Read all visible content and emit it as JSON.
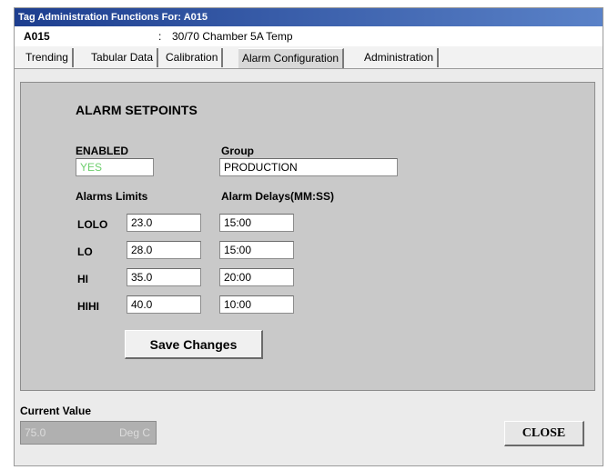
{
  "window": {
    "title": "Tag Administration Functions For: A015"
  },
  "tag": {
    "id": "A015",
    "separator": ":",
    "description": "30/70 Chamber 5A Temp"
  },
  "tabs": [
    {
      "label": "Trending",
      "active": false
    },
    {
      "label": "Tabular Data",
      "active": false
    },
    {
      "label": "Calibration",
      "active": false
    },
    {
      "label": "Alarm Configuration",
      "active": true
    },
    {
      "label": "Administration",
      "active": false
    }
  ],
  "alarm": {
    "heading": "ALARM SETPOINTS",
    "enabled_label": "ENABLED",
    "enabled_value": "YES",
    "group_label": "Group",
    "group_value": "PRODUCTION",
    "limits_label": "Alarms Limits",
    "delays_label": "Alarm Delays(MM:SS)",
    "rows": [
      {
        "name": "LOLO",
        "limit": "23.0",
        "delay": "15:00"
      },
      {
        "name": "LO",
        "limit": "28.0",
        "delay": "15:00"
      },
      {
        "name": "HI",
        "limit": "35.0",
        "delay": "20:00"
      },
      {
        "name": "HIHI",
        "limit": "40.0",
        "delay": "10:00"
      }
    ],
    "save_label": "Save Changes"
  },
  "current": {
    "label": "Current Value",
    "value": "75.0",
    "unit": "Deg C"
  },
  "close_label": "CLOSE",
  "colors": {
    "title_bar": "#1d3e8f",
    "enabled_text": "#6ecf6e",
    "panel": "#c9c9c9"
  }
}
